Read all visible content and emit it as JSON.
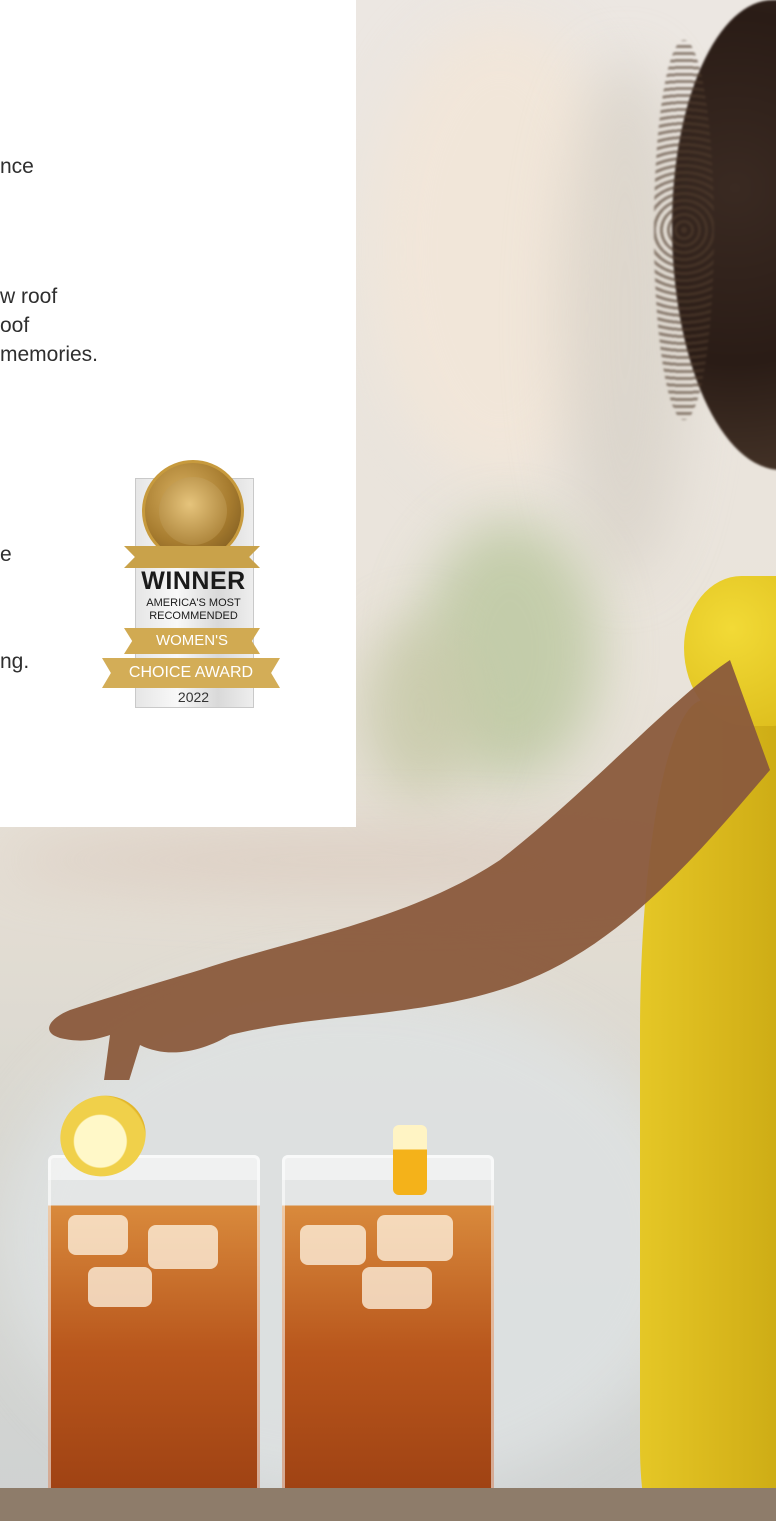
{
  "intro": {
    "line1": "nce"
  },
  "story": {
    "line1": "w roof",
    "line2": "oof",
    "line3": " memories."
  },
  "details": {
    "line1": "e",
    "line2": "ng."
  },
  "award": {
    "headline": "WINNER",
    "line1": "AMERICA'S MOST",
    "line2": "RECOMMENDED",
    "ribbon1": "WOMEN'S",
    "ribbon2": "CHOICE AWARD",
    "year": "2022"
  },
  "colors": {
    "card_background": "#ffffff",
    "body_text": "#2f2f2f",
    "award_gold": "#d3ad57",
    "dress_yellow": "#e5c726"
  }
}
